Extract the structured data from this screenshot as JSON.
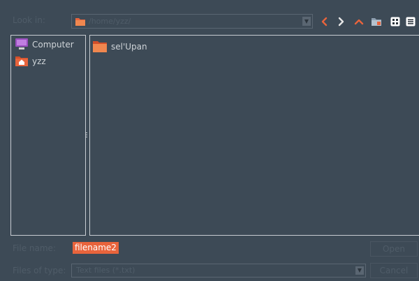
{
  "top": {
    "look_in_label": "Look in:",
    "path": "/home/yzz/",
    "icons": [
      "chevron-left-icon",
      "chevron-right-icon",
      "chevron-up-icon",
      "new-folder-icon",
      "icon-view-icon",
      "list-view-icon"
    ]
  },
  "sidebar": {
    "items": [
      {
        "label": "Computer",
        "icon": "computer-icon"
      },
      {
        "label": "yzz",
        "icon": "home-folder-icon"
      }
    ]
  },
  "files": {
    "items": [
      {
        "label": "sel'Upan",
        "icon": "folder-icon"
      }
    ]
  },
  "bottom": {
    "file_name_label": "File name:",
    "file_name_value": "filename2",
    "open_button": "Open",
    "file_type_label": "Files of type:",
    "file_type_value": "Text files (*.txt)",
    "cancel_button": "Cancel"
  },
  "colors": {
    "background": "#3d4a56",
    "accent": "#e8643c",
    "border": "#c8cdd2",
    "disabled_text": "#4f5c68"
  }
}
